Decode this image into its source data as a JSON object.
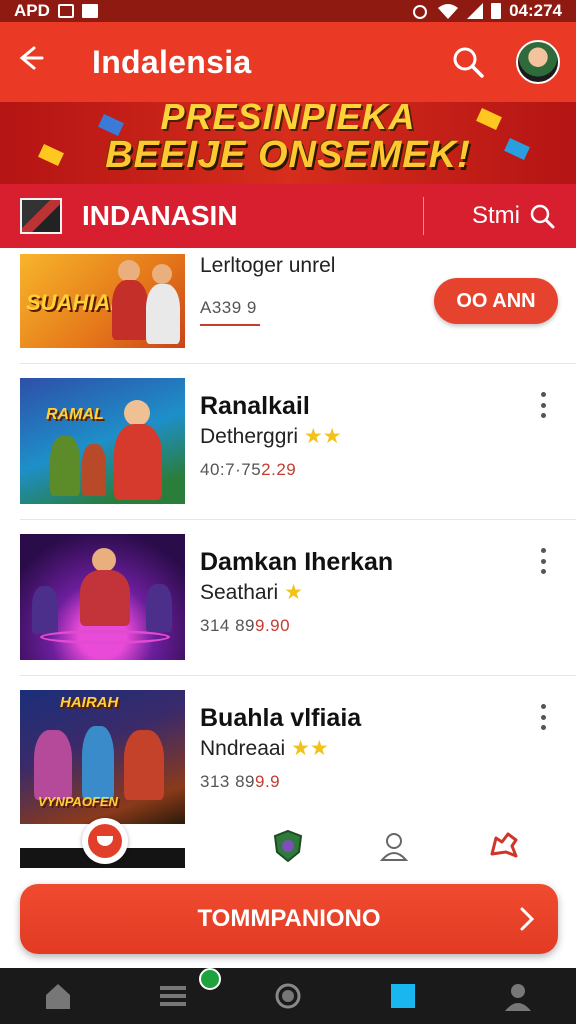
{
  "status_bar": {
    "left_text": "APD",
    "time": "04:274"
  },
  "app_bar": {
    "title": "Indalensia",
    "back_icon": "arrow-left-icon",
    "search_icon": "search-icon"
  },
  "banner": {
    "line1": "PRESINPIEKA",
    "line2": "BEEIJE ONSEMEK!"
  },
  "store_header": {
    "name": "INDANASIN",
    "search_label": "Stmi"
  },
  "items": [
    {
      "name": "",
      "subtitle": "Lerltoger unrel",
      "price": "A339 9",
      "price_red": "",
      "action": "OO ANN"
    },
    {
      "name": "Ranalkail",
      "subtitle": "Detherggri",
      "stars": "★★",
      "price": "40:7·75",
      "price_red": "2.29"
    },
    {
      "name": "Damkan Iherkan",
      "subtitle": "Seathari",
      "stars": "★",
      "price": "314 89",
      "price_red": "9.90"
    },
    {
      "name": "Buahla vlfiaia",
      "subtitle": "Nndreaai",
      "stars": "★★",
      "price": "313 89",
      "price_red": "9.9"
    }
  ],
  "thumb_texts": {
    "item1": "SUAHIAIN",
    "item2": "RAMAL",
    "item4_top": "HAIRAH",
    "item4_bottom": "VYNPAOFEN"
  },
  "cta": {
    "label": "TOMMPANIONO"
  },
  "colors": {
    "primary": "#ea3a26",
    "store_red": "#d81f2f",
    "nav_dark": "#1a1a1a",
    "star": "#f2c21b"
  },
  "bottom_nav": [
    "home-icon",
    "menu-icon",
    "circle-icon",
    "square-icon",
    "profile-icon"
  ]
}
